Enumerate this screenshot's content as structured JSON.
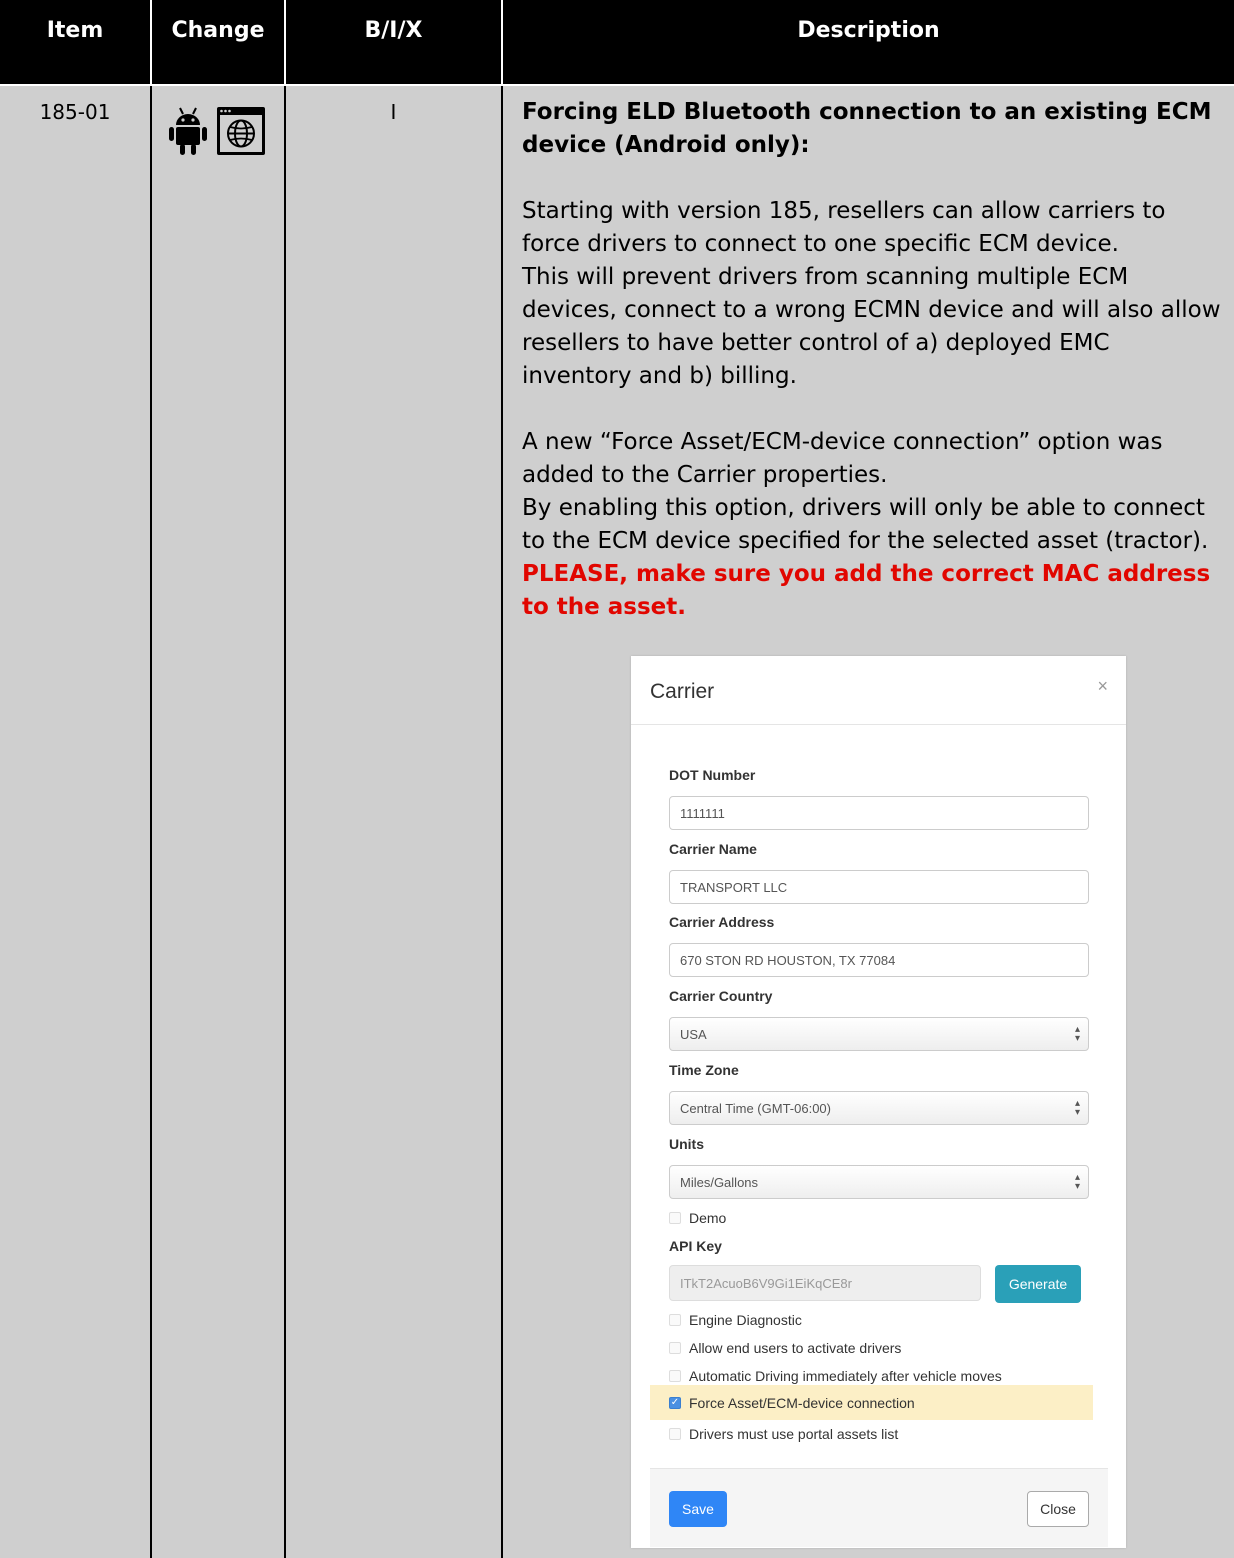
{
  "table": {
    "headers": [
      "Item",
      "Change",
      "B/I/X",
      "Description"
    ],
    "row": {
      "item": "185-01",
      "change_icons": [
        "android-icon",
        "web-icon"
      ],
      "bix": "I",
      "title": "Forcing ELD Bluetooth connection to an existing ECM device (Android only):",
      "para1": "Starting with version 185, resellers can allow carriers to force drivers to connect to one specific ECM device.",
      "para2": "This will prevent drivers from scanning multiple ECM devices, connect to a wrong ECMN device and will also allow resellers to have better control of a) deployed EMC inventory and b) billing.",
      "para3": "A new “Force Asset/ECM-device connection” option was added to the Carrier properties.",
      "para4": "By enabling this option, drivers will only be able to connect to the ECM device specified for the selected asset (tractor).",
      "warning": "PLEASE, make sure you add the correct MAC address to the asset."
    }
  },
  "dialog": {
    "title": "Carrier",
    "close_glyph": "×",
    "dot_label": "DOT Number",
    "dot_value": "1111111",
    "name_label": "Carrier Name",
    "name_value": "TRANSPORT LLC",
    "address_label": "Carrier Address",
    "address_value": "670 STON RD HOUSTON, TX  77084",
    "country_label": "Carrier Country",
    "country_value": "USA",
    "tz_label": "Time Zone",
    "tz_value": "Central Time (GMT-06:00)",
    "units_label": "Units",
    "units_value": "Miles/Gallons",
    "demo_label": "Demo",
    "api_label": "API Key",
    "api_value": "ITkT2AcuoB6V9Gi1EiKqCE8r",
    "generate_label": "Generate",
    "options": [
      {
        "label": "Engine Diagnostic",
        "checked": false
      },
      {
        "label": "Allow end users to activate drivers",
        "checked": false
      },
      {
        "label": "Automatic Driving immediately after vehicle moves",
        "checked": false
      },
      {
        "label": "Force Asset/ECM-device connection",
        "checked": true
      },
      {
        "label": "Drivers must use portal assets list",
        "checked": false
      }
    ],
    "save_label": "Save",
    "close_label": "Close"
  },
  "colors": {
    "header_bg": "#000000",
    "row_bg": "#cfcfcf",
    "warning": "#e10600",
    "highlight": "#fcefc6",
    "generate_btn": "#2aa0b8",
    "save_btn": "#2f86f6"
  }
}
